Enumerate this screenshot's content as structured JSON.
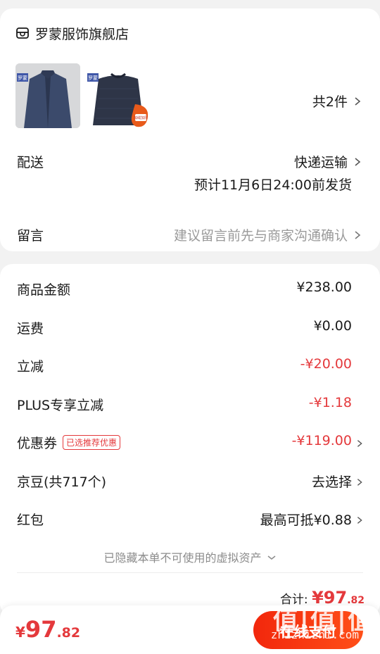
{
  "store": {
    "name": "罗蒙服饰旗舰店",
    "icon": "store-icon"
  },
  "products": {
    "count_label": "共2件",
    "items": [
      {
        "name": "jacket",
        "badge": "罗蒙"
      },
      {
        "name": "sweater",
        "badge": "罗蒙",
        "promo_badge": "加绒加厚"
      }
    ]
  },
  "delivery": {
    "label": "配送",
    "method": "快递运输",
    "eta": "预计11月6日24:00前发货"
  },
  "message": {
    "label": "留言",
    "placeholder": "建议留言前先与商家沟通确认"
  },
  "price": {
    "goods_amount": {
      "label": "商品金额",
      "value": "¥238.00"
    },
    "shipping": {
      "label": "运费",
      "value": "¥0.00"
    },
    "instant_discount": {
      "label": "立减",
      "value": "-¥20.00"
    },
    "plus_discount": {
      "label": "PLUS专享立减",
      "value": "-¥1.18"
    },
    "coupon": {
      "label": "优惠券",
      "tag": "已选推荐优惠",
      "value": "-¥119.00"
    },
    "jingdou": {
      "label": "京豆(共717个)",
      "value": "去选择"
    },
    "red_packet": {
      "label": "红包",
      "value": "最高可抵¥0.88"
    },
    "hidden_assets_note": "已隐藏本单不可使用的虚拟资产",
    "total_label": "合计:",
    "total_currency": "¥",
    "total_int": "97",
    "total_dec": ".82"
  },
  "bottom_bar": {
    "currency": "¥",
    "amount_int": "97",
    "amount_dec": ".82",
    "pay_label": "在线支付"
  },
  "watermark": {
    "text": "值|值|值",
    "url": "zhizhizhi.com"
  },
  "colors": {
    "accent_red": "#e4393c",
    "pay_gradient_start": "#f2270c",
    "pay_gradient_end": "#ff4f18"
  }
}
